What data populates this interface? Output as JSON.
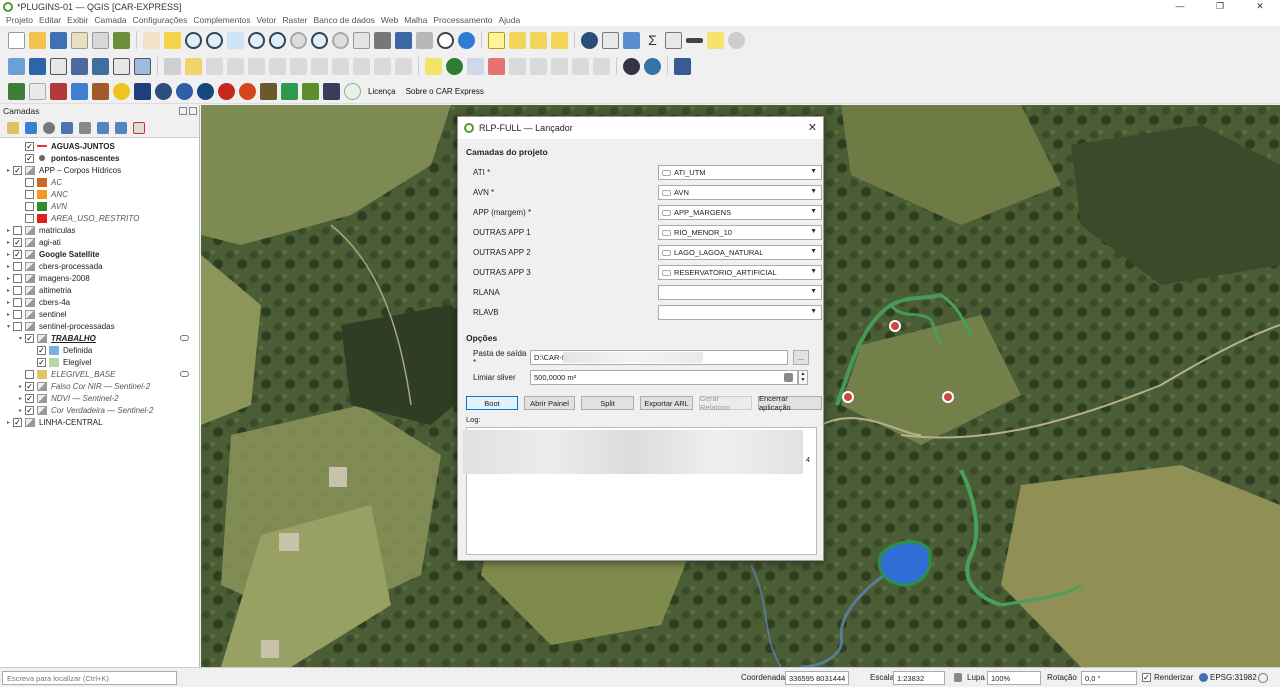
{
  "window": {
    "title": "*PLUGINS-01 — QGIS [CAR-EXPRESS]",
    "controls": [
      "—",
      "❐",
      "✕"
    ]
  },
  "menu": [
    "Projeto",
    "Editar",
    "Exibir",
    "Camada",
    "Configurações",
    "Complementos",
    "Vetor",
    "Raster",
    "Banco de dados",
    "Web",
    "Malha",
    "Processamento",
    "Ajuda"
  ],
  "toolbar3": {
    "license": "Licença",
    "about": "Sobre o CAR Express"
  },
  "layers_panel": {
    "title": "Camadas",
    "items": [
      {
        "label": "AGUAS-JUNTOS",
        "checked": "✓",
        "arrow": "",
        "symbol": "#e3342f",
        "style": "bold",
        "indent": 1
      },
      {
        "label": "pontos-nascentes",
        "checked": "✓",
        "arrow": "",
        "symbol": "#666666",
        "style": "bold",
        "indent": 1
      },
      {
        "label": "APP – Corpos Hídricos",
        "checked": "✓",
        "arrow": "▸",
        "symbol": "",
        "style": "",
        "indent": 0
      },
      {
        "label": "AC",
        "checked": "",
        "arrow": "",
        "symbol": "#c96a28",
        "style": "ital",
        "indent": 1
      },
      {
        "label": "ANC",
        "checked": "",
        "arrow": "",
        "symbol": "#f19a23",
        "style": "ital",
        "indent": 1
      },
      {
        "label": "AVN",
        "checked": "",
        "arrow": "",
        "symbol": "#2f8f2f",
        "style": "ital",
        "indent": 1
      },
      {
        "label": "AREA_USO_RESTRITO",
        "checked": "",
        "arrow": "",
        "symbol": "#e02020",
        "style": "ital",
        "indent": 1
      },
      {
        "label": "matriculas",
        "checked": "",
        "arrow": "▸",
        "symbol": "",
        "style": "",
        "indent": 0
      },
      {
        "label": "agi-ati",
        "checked": "✓",
        "arrow": "▸",
        "symbol": "",
        "style": "",
        "indent": 0
      },
      {
        "label": "Google Satellite",
        "checked": "✓",
        "arrow": "▸",
        "symbol": "",
        "style": "bold",
        "indent": 0
      },
      {
        "label": "cbers-processada",
        "checked": "",
        "arrow": "▸",
        "symbol": "",
        "style": "",
        "indent": 0
      },
      {
        "label": "imagens-2008",
        "checked": "",
        "arrow": "▸",
        "symbol": "",
        "style": "",
        "indent": 0
      },
      {
        "label": "altimetria",
        "checked": "",
        "arrow": "▸",
        "symbol": "",
        "style": "",
        "indent": 0
      },
      {
        "label": "cbers-4a",
        "checked": "",
        "arrow": "▸",
        "symbol": "",
        "style": "",
        "indent": 0
      },
      {
        "label": "sentinel",
        "checked": "",
        "arrow": "▸",
        "symbol": "",
        "style": "",
        "indent": 0
      },
      {
        "label": "sentinel-processadas",
        "checked": "",
        "arrow": "▾",
        "symbol": "",
        "style": "",
        "indent": 0
      },
      {
        "label": "TRABALHO",
        "checked": "✓",
        "arrow": "▾",
        "symbol": "",
        "style": "bold-ital",
        "indent": 1
      },
      {
        "label": "Definida",
        "checked": "✓",
        "arrow": "",
        "symbol": "#7fb0d8",
        "style": "",
        "indent": 2
      },
      {
        "label": "Elegível",
        "checked": "✓",
        "arrow": "",
        "symbol": "#b9d8a6",
        "style": "",
        "indent": 2
      },
      {
        "label": "ELEGIVEL_BASE",
        "checked": "",
        "arrow": "",
        "symbol": "#e2c36b",
        "style": "ital",
        "indent": 1
      },
      {
        "label": "Falso Cor NIR — Sentinel-2",
        "checked": "✓",
        "arrow": "▸",
        "symbol": "",
        "style": "ital",
        "indent": 1
      },
      {
        "label": "NDVI — Sentinel-2",
        "checked": "✓",
        "arrow": "▸",
        "symbol": "",
        "style": "ital",
        "indent": 1
      },
      {
        "label": "Cor Verdadeira — Sentinel-2",
        "checked": "✓",
        "arrow": "▸",
        "symbol": "",
        "style": "ital",
        "indent": 1
      },
      {
        "label": "LINHA-CENTRAL",
        "checked": "✓",
        "arrow": "▸",
        "symbol": "",
        "style": "",
        "indent": 0
      }
    ]
  },
  "dialog": {
    "title": "RLP-FULL — Lançador",
    "close": "✕",
    "section_layers": "Camadas do projeto",
    "fields": [
      {
        "label": "ATI *",
        "value": "ATI_UTM",
        "has_layer": true
      },
      {
        "label": "AVN *",
        "value": "AVN",
        "has_layer": true
      },
      {
        "label": "APP (margem) *",
        "value": "APP_MARGENS",
        "has_layer": true
      },
      {
        "label": "OUTRAS APP 1",
        "value": "RIO_MENOR_10",
        "has_layer": true
      },
      {
        "label": "OUTRAS APP 2",
        "value": "LAGO_LAGOA_NATURAL",
        "has_layer": true
      },
      {
        "label": "OUTRAS APP 3",
        "value": "RESERVATORIO_ARTIFICIAL",
        "has_layer": true
      },
      {
        "label": "RLANA",
        "value": "",
        "has_layer": false
      },
      {
        "label": "RLAVB",
        "value": "",
        "has_layer": false
      }
    ],
    "section_options": "Opções",
    "output_label": "Pasta de saída *",
    "output_value": "D:\\CAR-E",
    "browse_label": "...",
    "sliver_label": "Limiar sliver",
    "sliver_value": "500,0000 m²",
    "buttons": [
      "Boot",
      "Abrir Painel",
      "Split",
      "Exportar ARL",
      "Gerar Relatório",
      "Encerrar aplicação"
    ],
    "log_label": "Log:",
    "log_tail": "4"
  },
  "statusbar": {
    "locate_placeholder": "Escreva para localizar (Ctrl+K)",
    "coord_label": "Coordenada",
    "coord_value": "336595  8031444",
    "scale_label": "Escala",
    "scale_value": "1:23832",
    "zoom_label": "Lupa",
    "zoom_value": "100%",
    "rotation_label": "Rotação",
    "rotation_value": "0,0 °",
    "render_label": "Renderizar",
    "crs": "EPSG:31982"
  }
}
